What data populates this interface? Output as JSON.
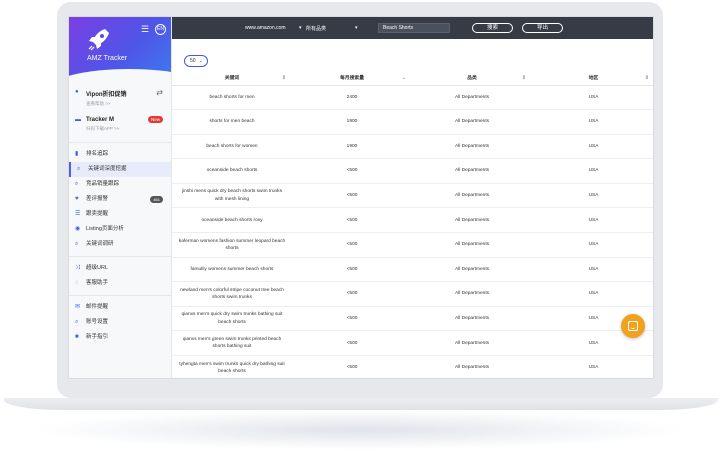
{
  "sidebar": {
    "app_name": "AMZ Tracker",
    "menu_icon": "hamburger-icon",
    "lang": "EN",
    "accounts": [
      {
        "title": "Vipon折扣促销",
        "sub": "查看帮助 >>",
        "icon": "gift-icon",
        "right_icon": "swap-icon"
      },
      {
        "title": "Tracker M",
        "sub": "扫码下载APP >>",
        "icon": "chat-icon",
        "badge": "New"
      }
    ],
    "group1": [
      {
        "label": "排名追踪",
        "icon": "bar-chart-icon"
      },
      {
        "label": "关键词深度挖掘",
        "icon": "search-icon",
        "active": true
      },
      {
        "label": "竞品销量跟踪",
        "icon": "search-icon"
      },
      {
        "label": "差评报警",
        "icon": "heart-icon",
        "count": "461"
      },
      {
        "label": "跟卖提醒",
        "icon": "list-icon"
      },
      {
        "label": "Listing页面分析",
        "icon": "eye-icon"
      },
      {
        "label": "关键词调研",
        "icon": "search-icon"
      }
    ],
    "group2": [
      {
        "label": "超级URL",
        "icon": "shuffle-icon"
      },
      {
        "label": "客服助手",
        "icon": "chat-icon"
      }
    ],
    "group3": [
      {
        "label": "邮件提醒",
        "icon": "mail-icon"
      },
      {
        "label": "账号设置",
        "icon": "search-icon"
      },
      {
        "label": "新手指引",
        "icon": "video-icon"
      }
    ]
  },
  "topbar": {
    "domain": "www.amazon.com",
    "category": "所有品类",
    "search_value": "Beach Shorts",
    "search_button": "搜索",
    "export_button": "导出"
  },
  "pager": {
    "page_size": "50"
  },
  "table": {
    "headers": [
      "关键词",
      "每月搜索量",
      "品类",
      "地区"
    ],
    "rows": [
      [
        "beach shorts for men",
        "2400",
        "All Departments",
        "USA"
      ],
      [
        "shorts for men beach",
        "1900",
        "All Departments",
        "USA"
      ],
      [
        "beach shorts for women",
        "1900",
        "All Departments",
        "USA"
      ],
      [
        "oceanside beach shorts",
        "<500",
        "All Departments",
        "USA"
      ],
      [
        "jinshi mens quick dry beach shorts swim trunks with mesh lining",
        "<500",
        "All Departments",
        "USA"
      ],
      [
        "oceanside beach shorts roxy",
        "<500",
        "All Departments",
        "USA"
      ],
      [
        "kaferman womens fashion summer leopard beach shorts",
        "<500",
        "All Departments",
        "USA"
      ],
      [
        "famulily womens summer beach shorts",
        "<500",
        "All Departments",
        "USA"
      ],
      [
        "newland men's colorful stripe coconut tree beach shorts swim trunks",
        "<500",
        "All Departments",
        "USA"
      ],
      [
        "qianxs men's quick dry swim trunks bathing suit beach shorts",
        "<500",
        "All Departments",
        "USA"
      ],
      [
        "qianxs men's green swim trunks printed beach shorts bathing suit",
        "<500",
        "All Departments",
        "USA"
      ],
      [
        "tyhengta men's swim trunks quick dry bathing suit beach shorts",
        "<500",
        "All Departments",
        "USA"
      ]
    ]
  }
}
